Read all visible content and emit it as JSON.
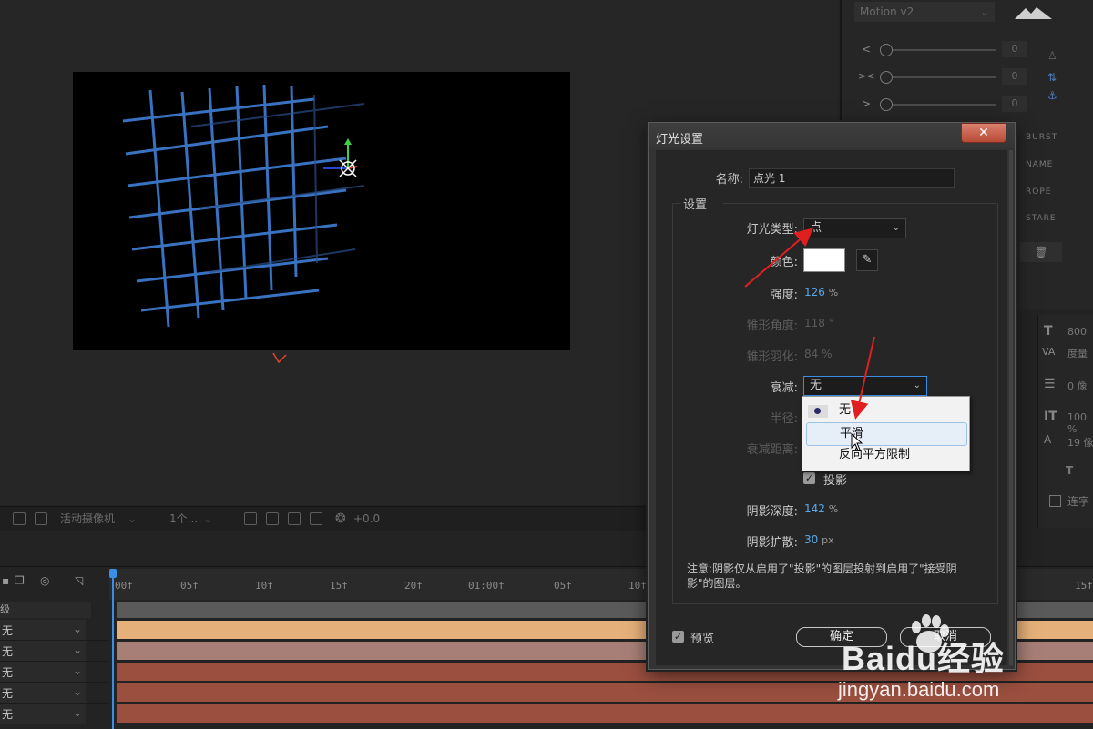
{
  "viewer_toolbar": {
    "camera_select": "活动摄像机",
    "view_count_select": "1个...",
    "exposure_value": "+0.0"
  },
  "motion_panel": {
    "preset_select": "Motion v2",
    "slider_values": [
      "0",
      "0",
      "0"
    ],
    "labels": [
      "BURST",
      "NAME",
      "ROPE",
      "STARE"
    ]
  },
  "char_panel": {
    "font_size": "800",
    "tracking_label": "度量",
    "indent_value": "0 像",
    "scale_value": "100 %",
    "baseline_value": "19 像",
    "checkbox_label": "连字"
  },
  "timeline": {
    "header_label": "级",
    "layers": [
      {
        "mode": "无",
        "color": "#e6b07a"
      },
      {
        "mode": "无",
        "color": "#a77f76"
      },
      {
        "mode": "无",
        "color": "#9a4f3f"
      },
      {
        "mode": "无",
        "color": "#9a4f3f"
      },
      {
        "mode": "无",
        "color": "#9a4f3f"
      }
    ],
    "ruler": [
      "00f",
      "05f",
      "10f",
      "15f",
      "20f",
      "01:00f",
      "05f",
      "10f",
      "15f"
    ]
  },
  "dialog": {
    "title": "灯光设置",
    "close_label": "✕",
    "name_label": "名称:",
    "name_value": "点光 1",
    "settings_group": "设置",
    "light_type_label": "灯光类型:",
    "light_type_value": "点",
    "color_label": "颜色:",
    "color_value": "#ffffff",
    "intensity_label": "强度:",
    "intensity_value": "126",
    "intensity_unit": "%",
    "cone_angle_label": "锥形角度:",
    "cone_angle_value": "118 °",
    "cone_feather_label": "锥形羽化:",
    "cone_feather_value": "84 %",
    "falloff_label": "衰减:",
    "falloff_value": "无",
    "radius_label": "半径:",
    "falloff_distance_label": "衰减距离:",
    "casts_shadows_label": "投影",
    "shadow_darkness_label": "阴影深度:",
    "shadow_darkness_value": "142",
    "shadow_darkness_unit": "%",
    "shadow_diffusion_label": "阴影扩散:",
    "shadow_diffusion_value": "30",
    "shadow_diffusion_unit": "px",
    "note": "注意:阴影仅从启用了\"投影\"的图层投射到启用了\"接受阴影\"的图层。",
    "preview_label": "预览",
    "ok_label": "确定",
    "cancel_label": "取消"
  },
  "falloff_dropdown": {
    "options": [
      "无",
      "平滑",
      "反向平方限制"
    ],
    "selected_index": 0,
    "hover_index": 1
  },
  "watermark": {
    "brand": "Baidu经验",
    "url": "jingyan.baidu.com"
  }
}
